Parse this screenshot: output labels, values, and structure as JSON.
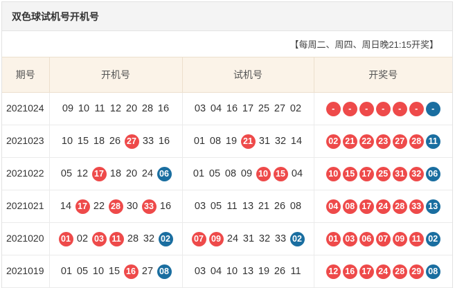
{
  "title": "双色球试机号开机号",
  "note": "【每周二、周四、周日晚21:15开奖】",
  "colors": {
    "red_ball": "#ee4a4a",
    "blue_ball": "#1a6ea0",
    "header_bg": "#fbf3e8"
  },
  "headers": {
    "issue": "期号",
    "open": "开机号",
    "trial": "试机号",
    "draw": "开奖号"
  },
  "rows": [
    {
      "issue": "2021024",
      "open": [
        {
          "v": "09",
          "c": ""
        },
        {
          "v": "10",
          "c": ""
        },
        {
          "v": "11",
          "c": ""
        },
        {
          "v": "12",
          "c": ""
        },
        {
          "v": "20",
          "c": ""
        },
        {
          "v": "28",
          "c": ""
        },
        {
          "v": "16",
          "c": ""
        }
      ],
      "trial": [
        {
          "v": "03",
          "c": ""
        },
        {
          "v": "04",
          "c": ""
        },
        {
          "v": "16",
          "c": ""
        },
        {
          "v": "17",
          "c": ""
        },
        {
          "v": "25",
          "c": ""
        },
        {
          "v": "27",
          "c": ""
        },
        {
          "v": "02",
          "c": ""
        }
      ],
      "draw": [
        {
          "v": "-",
          "c": "red"
        },
        {
          "v": "-",
          "c": "red"
        },
        {
          "v": "-",
          "c": "red"
        },
        {
          "v": "-",
          "c": "red"
        },
        {
          "v": "-",
          "c": "red"
        },
        {
          "v": "-",
          "c": "red"
        },
        {
          "v": "-",
          "c": "blue"
        }
      ]
    },
    {
      "issue": "2021023",
      "open": [
        {
          "v": "10",
          "c": ""
        },
        {
          "v": "15",
          "c": ""
        },
        {
          "v": "18",
          "c": ""
        },
        {
          "v": "26",
          "c": ""
        },
        {
          "v": "27",
          "c": "red"
        },
        {
          "v": "33",
          "c": ""
        },
        {
          "v": "16",
          "c": ""
        }
      ],
      "trial": [
        {
          "v": "01",
          "c": ""
        },
        {
          "v": "08",
          "c": ""
        },
        {
          "v": "19",
          "c": ""
        },
        {
          "v": "21",
          "c": "red"
        },
        {
          "v": "31",
          "c": ""
        },
        {
          "v": "32",
          "c": ""
        },
        {
          "v": "14",
          "c": ""
        }
      ],
      "draw": [
        {
          "v": "02",
          "c": "red"
        },
        {
          "v": "21",
          "c": "red"
        },
        {
          "v": "22",
          "c": "red"
        },
        {
          "v": "23",
          "c": "red"
        },
        {
          "v": "27",
          "c": "red"
        },
        {
          "v": "28",
          "c": "red"
        },
        {
          "v": "11",
          "c": "blue"
        }
      ]
    },
    {
      "issue": "2021022",
      "open": [
        {
          "v": "05",
          "c": ""
        },
        {
          "v": "12",
          "c": ""
        },
        {
          "v": "17",
          "c": "red"
        },
        {
          "v": "18",
          "c": ""
        },
        {
          "v": "20",
          "c": ""
        },
        {
          "v": "24",
          "c": ""
        },
        {
          "v": "06",
          "c": "blue"
        }
      ],
      "trial": [
        {
          "v": "01",
          "c": ""
        },
        {
          "v": "05",
          "c": ""
        },
        {
          "v": "08",
          "c": ""
        },
        {
          "v": "09",
          "c": ""
        },
        {
          "v": "10",
          "c": "red"
        },
        {
          "v": "15",
          "c": "red"
        },
        {
          "v": "04",
          "c": ""
        }
      ],
      "draw": [
        {
          "v": "10",
          "c": "red"
        },
        {
          "v": "15",
          "c": "red"
        },
        {
          "v": "17",
          "c": "red"
        },
        {
          "v": "25",
          "c": "red"
        },
        {
          "v": "31",
          "c": "red"
        },
        {
          "v": "32",
          "c": "red"
        },
        {
          "v": "06",
          "c": "blue"
        }
      ]
    },
    {
      "issue": "2021021",
      "open": [
        {
          "v": "14",
          "c": ""
        },
        {
          "v": "17",
          "c": "red"
        },
        {
          "v": "22",
          "c": ""
        },
        {
          "v": "28",
          "c": "red"
        },
        {
          "v": "30",
          "c": ""
        },
        {
          "v": "33",
          "c": "red"
        },
        {
          "v": "16",
          "c": ""
        }
      ],
      "trial": [
        {
          "v": "03",
          "c": ""
        },
        {
          "v": "05",
          "c": ""
        },
        {
          "v": "11",
          "c": ""
        },
        {
          "v": "13",
          "c": ""
        },
        {
          "v": "21",
          "c": ""
        },
        {
          "v": "26",
          "c": ""
        },
        {
          "v": "08",
          "c": ""
        }
      ],
      "draw": [
        {
          "v": "04",
          "c": "red"
        },
        {
          "v": "08",
          "c": "red"
        },
        {
          "v": "17",
          "c": "red"
        },
        {
          "v": "24",
          "c": "red"
        },
        {
          "v": "28",
          "c": "red"
        },
        {
          "v": "33",
          "c": "red"
        },
        {
          "v": "13",
          "c": "blue"
        }
      ]
    },
    {
      "issue": "2021020",
      "open": [
        {
          "v": "01",
          "c": "red"
        },
        {
          "v": "02",
          "c": ""
        },
        {
          "v": "03",
          "c": "red"
        },
        {
          "v": "11",
          "c": "red"
        },
        {
          "v": "28",
          "c": ""
        },
        {
          "v": "32",
          "c": ""
        },
        {
          "v": "02",
          "c": "blue"
        }
      ],
      "trial": [
        {
          "v": "07",
          "c": "red"
        },
        {
          "v": "09",
          "c": "red"
        },
        {
          "v": "24",
          "c": ""
        },
        {
          "v": "31",
          "c": ""
        },
        {
          "v": "32",
          "c": ""
        },
        {
          "v": "33",
          "c": ""
        },
        {
          "v": "02",
          "c": "blue"
        }
      ],
      "draw": [
        {
          "v": "01",
          "c": "red"
        },
        {
          "v": "03",
          "c": "red"
        },
        {
          "v": "06",
          "c": "red"
        },
        {
          "v": "07",
          "c": "red"
        },
        {
          "v": "09",
          "c": "red"
        },
        {
          "v": "11",
          "c": "red"
        },
        {
          "v": "02",
          "c": "blue"
        }
      ]
    },
    {
      "issue": "2021019",
      "open": [
        {
          "v": "01",
          "c": ""
        },
        {
          "v": "05",
          "c": ""
        },
        {
          "v": "10",
          "c": ""
        },
        {
          "v": "15",
          "c": ""
        },
        {
          "v": "16",
          "c": "red"
        },
        {
          "v": "27",
          "c": ""
        },
        {
          "v": "08",
          "c": "blue"
        }
      ],
      "trial": [
        {
          "v": "03",
          "c": ""
        },
        {
          "v": "04",
          "c": ""
        },
        {
          "v": "10",
          "c": ""
        },
        {
          "v": "13",
          "c": ""
        },
        {
          "v": "19",
          "c": ""
        },
        {
          "v": "26",
          "c": ""
        },
        {
          "v": "11",
          "c": ""
        }
      ],
      "draw": [
        {
          "v": "12",
          "c": "red"
        },
        {
          "v": "16",
          "c": "red"
        },
        {
          "v": "17",
          "c": "red"
        },
        {
          "v": "24",
          "c": "red"
        },
        {
          "v": "28",
          "c": "red"
        },
        {
          "v": "29",
          "c": "red"
        },
        {
          "v": "08",
          "c": "blue"
        }
      ]
    }
  ]
}
